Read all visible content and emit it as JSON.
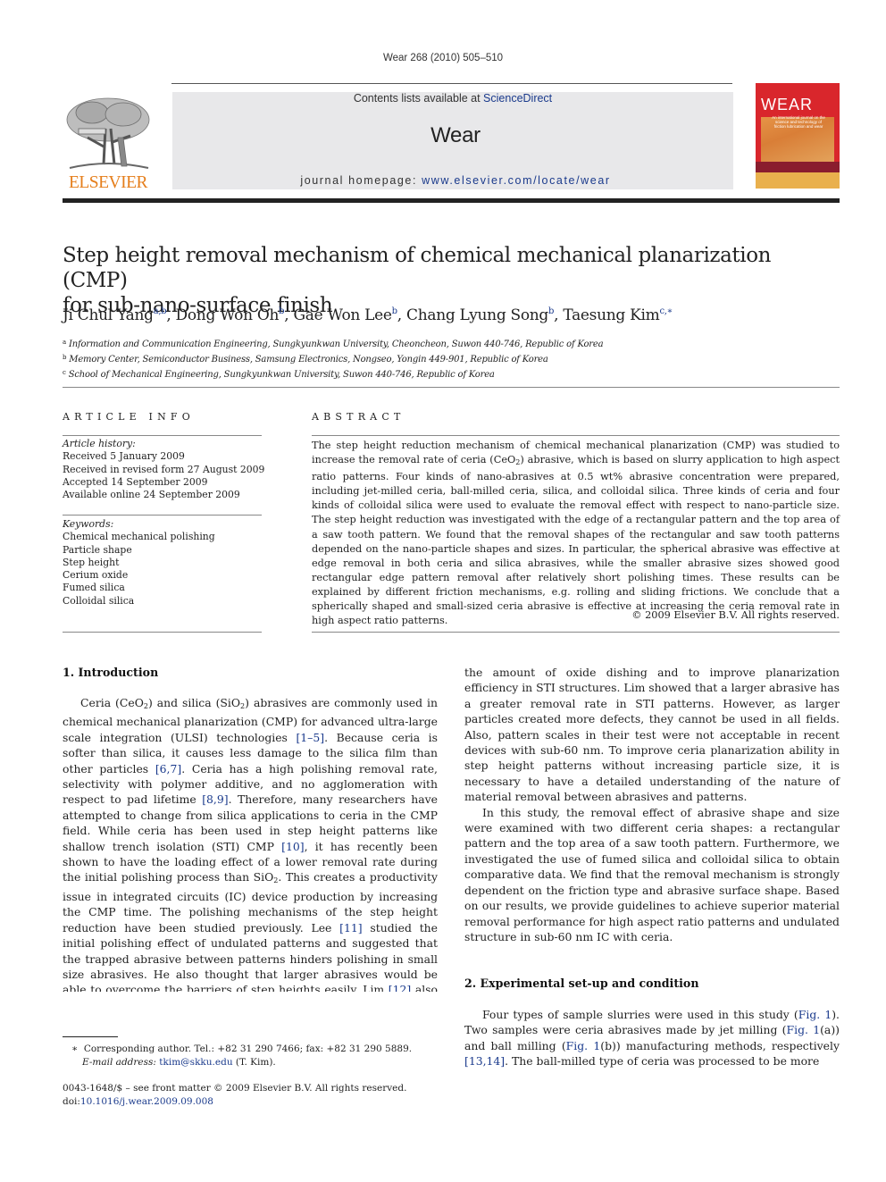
{
  "header": {
    "journal_ref": "Wear 268 (2010) 505–510",
    "contents_prefix": "Contents lists available at ",
    "contents_link": "ScienceDirect",
    "journal_name": "Wear",
    "homepage_prefix": "journal homepage: ",
    "homepage_link": "www.elsevier.com/locate/wear",
    "publisher_logo_text": "ELSEVIER",
    "cover_title": "WEAR",
    "cover_subtitle": "An international journal on the science and technology of friction lubrication and wear",
    "colors": {
      "elsevier_orange": "#e57e1b",
      "link_blue": "#1a3a8c",
      "cover_red": "#d9262c"
    }
  },
  "article": {
    "title_line1": "Step height removal mechanism of chemical mechanical planarization (CMP)",
    "title_line2": "for sub-nano-surface finish",
    "authors": [
      {
        "name": "Ji Chul Yang",
        "sup": "a,b",
        "sep": ", "
      },
      {
        "name": "Dong Won Oh",
        "sup": "b",
        "sep": ", "
      },
      {
        "name": "Gae Won Lee",
        "sup": "b",
        "sep": ", "
      },
      {
        "name": "Chang Lyung Song",
        "sup": "b",
        "sep": ", "
      },
      {
        "name": "Taesung Kim",
        "sup": "c,∗",
        "sep": ""
      }
    ],
    "affiliations": [
      {
        "mark": "a",
        "text": "Information and Communication Engineering, Sungkyunkwan University, Cheoncheon, Suwon 440-746, Republic of Korea"
      },
      {
        "mark": "b",
        "text": "Memory Center, Semiconductor Business, Samsung Electronics, Nongseo, Yongin 449-901, Republic of Korea"
      },
      {
        "mark": "c",
        "text": "School of Mechanical Engineering, Sungkyunkwan University, Suwon 440-746, Republic of Korea"
      }
    ]
  },
  "article_info": {
    "heading": "ARTICLE INFO",
    "history_label": "Article history:",
    "history": [
      "Received 5 January 2009",
      "Received in revised form 27 August 2009",
      "Accepted 14 September 2009",
      "Available online 24 September 2009"
    ],
    "keywords_label": "Keywords:",
    "keywords": [
      "Chemical mechanical polishing",
      "Particle shape",
      "Step height",
      "Cerium oxide",
      "Fumed silica",
      "Colloidal silica"
    ]
  },
  "abstract": {
    "heading": "ABSTRACT",
    "part1": "The step height reduction mechanism of chemical mechanical planarization (CMP) was studied to increase the removal rate of ceria (CeO",
    "sub1": "2",
    "part2": ") abrasive, which is based on slurry application to high aspect ratio patterns. Four kinds of nano-abrasives at 0.5 wt% abrasive concentration were prepared, including jet-milled ceria, ball-milled ceria, silica, and colloidal silica. Three kinds of ceria and four kinds of colloidal silica were used to evaluate the removal effect with respect to nano-particle size. The step height reduction was investigated with the edge of a rectangular pattern and the top area of a saw tooth pattern. We found that the removal shapes of the rectangular and saw tooth patterns depended on the nano-particle shapes and sizes. In particular, the spherical abrasive was effective at edge removal in both ceria and silica abrasives, while the smaller abrasive sizes showed good rectangular edge pattern removal after relatively short polishing times. These results can be explained by different friction mechanisms, e.g. rolling and sliding frictions. We conclude that a spherically shaped and small-sized ceria abrasive is effective at increasing the ceria removal rate in high aspect ratio patterns.",
    "copyright": "© 2009 Elsevier B.V. All rights reserved."
  },
  "intro": {
    "heading": "1.  Introduction",
    "p1": {
      "t1": "Ceria (CeO",
      "s1": "2",
      "t2": ") and silica (SiO",
      "s2": "2",
      "t3": ") abrasives are commonly used in chemical mechanical planarization (CMP) for advanced ultra-large scale integration (ULSI) technologies ",
      "r1": "[1–5]",
      "t4": ". Because ceria is softer than silica, it causes less damage to the silica film than other particles ",
      "r2": "[6,7]",
      "t5": ". Ceria has a high polishing removal rate, selectivity with polymer additive, and no agglomeration with respect to pad lifetime ",
      "r3": "[8,9]",
      "t6": ". Therefore, many researchers have attempted to change from silica applications to ceria in the CMP field. While ceria has been used in step height patterns like shallow trench isolation (STI) CMP ",
      "r4": "[10]",
      "t7": ", it has recently been shown to have the loading effect of a lower removal rate during the initial polishing process than SiO",
      "s3": "2",
      "t8": ". This creates a productivity issue in integrated circuits (IC) device production by increasing the CMP time. The polishing mechanisms of the step height reduction have been studied previously. Lee ",
      "r5": "[11]",
      "t9": " studied the initial polishing effect of undulated patterns and suggested that the trapped abrasive between patterns hinders polishing in small size abrasives. He also thought that larger abrasives would be able to overcome the barriers of step heights easily. Lim ",
      "r6": "[12]",
      "t10": " also studied the effect of ceria abrasive size to minimize the amount of oxide dishing and to improve planarization efficiency in STI structures. Lim showed that a larger abrasive has a greater removal rate in STI patterns. However, as larger particles created more defects, they cannot be used in all fields. Also, pattern scales in their test were not acceptable in recent devices with sub-60 nm. To improve ceria planarization ability in step height patterns without increasing particle size, it is necessary to have a detailed understanding of the nature of material removal between abrasives and patterns."
    },
    "p2": "In this study, the removal effect of abrasive shape and size were examined with two different ceria shapes: a rectangular pattern and the top area of a saw tooth pattern. Furthermore, we investigated the use of fumed silica and colloidal silica to obtain comparative data. We find that the removal mechanism is strongly dependent on the friction type and abrasive surface shape. Based on our results, we provide guidelines to achieve superior material removal performance for high aspect ratio patterns and undulated structure in sub-60 nm IC with ceria."
  },
  "section2": {
    "heading": "2.  Experimental set-up and condition",
    "t1": "Four types of sample slurries were used in this study (",
    "f1": "Fig. 1",
    "t2": "). Two samples were ceria abrasives made by jet milling (",
    "f2": "Fig. 1",
    "t3": "(a)) and ball milling (",
    "f3": "Fig. 1",
    "t4": "(b)) manufacturing methods, respectively ",
    "r1": "[13,14]",
    "t5": ". The ball-milled type of ceria was processed to be more"
  },
  "footnote": {
    "star": "∗",
    "corresponding": "Corresponding author. Tel.: +82 31 290 7466; fax: +82 31 290 5889.",
    "email_label": "E-mail address: ",
    "email": "tkim@skku.edu",
    "email_suffix": " (T. Kim).",
    "front_matter": "0043-1648/$ – see front matter © 2009 Elsevier B.V. All rights reserved.",
    "doi_label": "doi:",
    "doi": "10.1016/j.wear.2009.09.008"
  }
}
